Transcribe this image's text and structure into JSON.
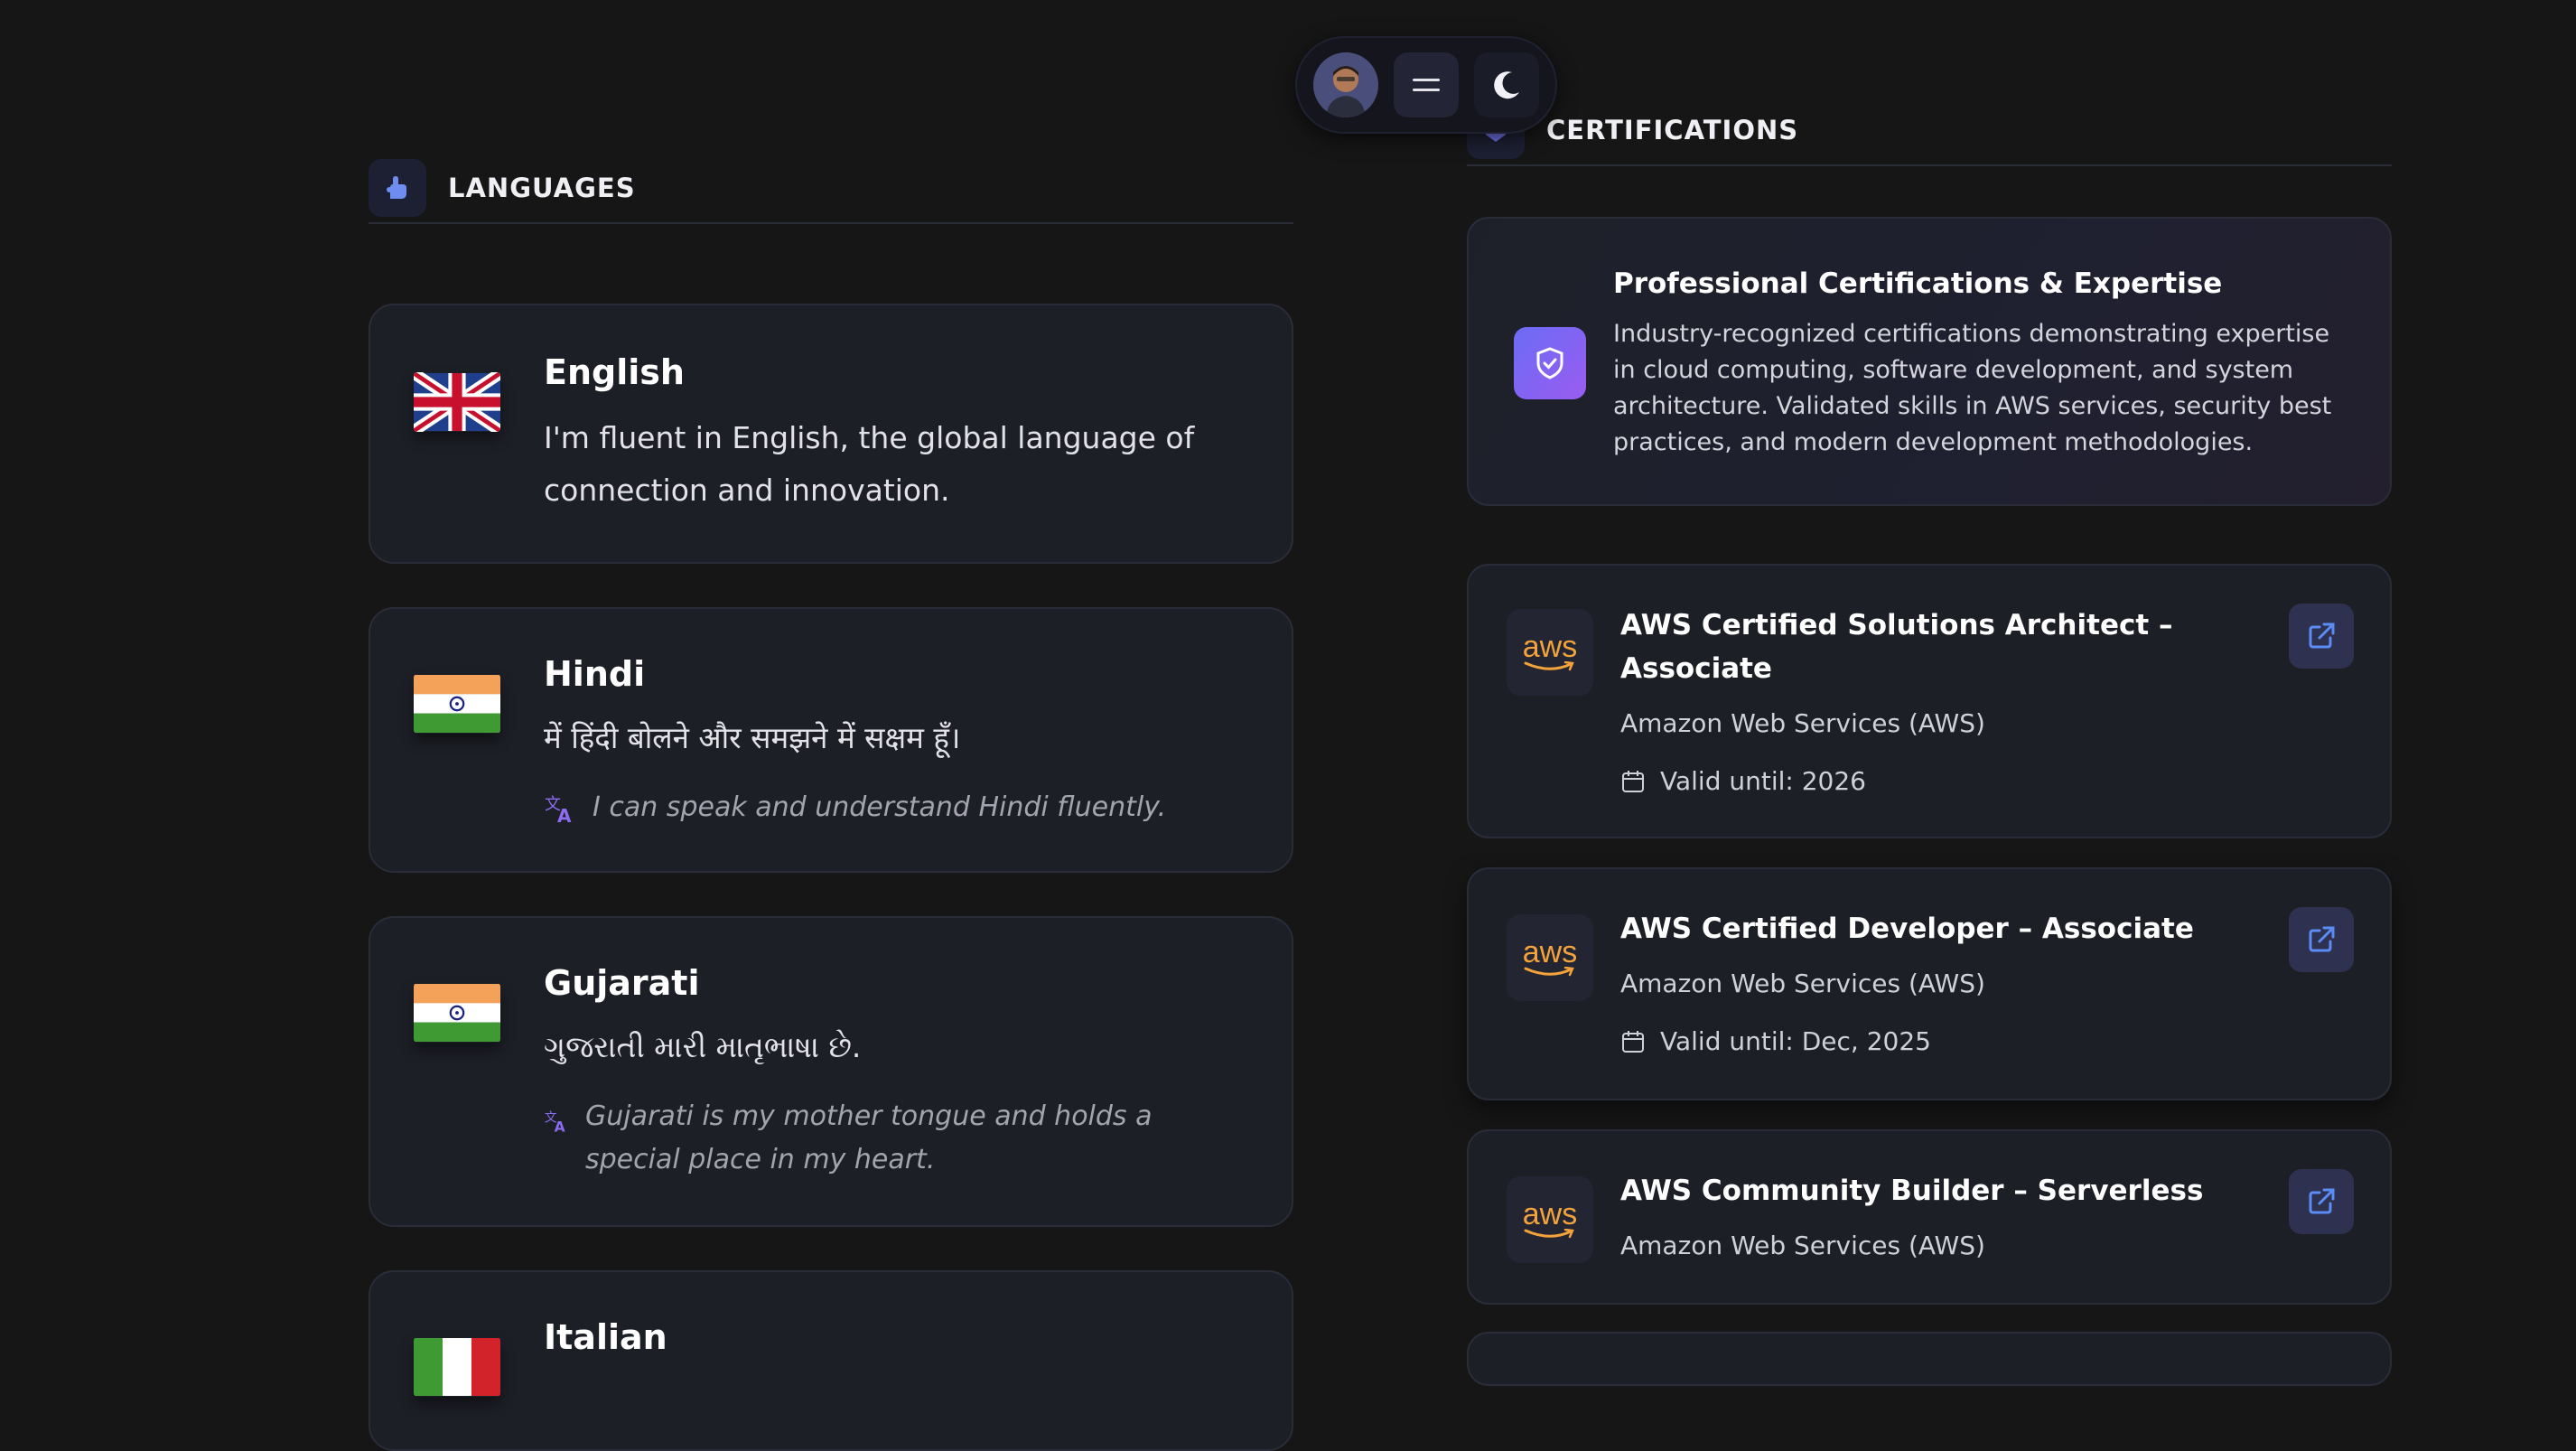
{
  "nav": {
    "avatar_alt": "profile avatar",
    "menu_icon": "menu-icon",
    "theme_icon": "moon-icon"
  },
  "languages": {
    "title": "LANGUAGES",
    "icon": "hand-icon",
    "items": [
      {
        "name": "English",
        "flag": "uk-flag",
        "description": "I'm fluent in English, the global language of connection and innovation."
      },
      {
        "name": "Hindi",
        "flag": "india-flag",
        "description": "में हिंदी बोलने और समझने में सक्षम हूँ।",
        "translation": "I can speak and understand Hindi fluently."
      },
      {
        "name": "Gujarati",
        "flag": "india-flag",
        "description": "ગુજરાતી મારી માતૃભાષા છે.",
        "translation": "Gujarati is my mother tongue and holds a special place in my heart."
      },
      {
        "name": "Italian",
        "flag": "italy-flag"
      }
    ]
  },
  "certifications": {
    "title": "CERTIFICATIONS",
    "icon": "shield-icon",
    "hero": {
      "title": "Professional Certifications & Expertise",
      "description": "Industry-recognized certifications demonstrating expertise in cloud computing, software development, and system architecture. Validated skills in AWS services, security best practices, and modern development methodologies."
    },
    "logo_text": "aws",
    "items": [
      {
        "title": "AWS Certified Solutions Architect – Associate",
        "issuer": "Amazon Web Services (AWS)",
        "valid": "Valid until: 2026"
      },
      {
        "title": "AWS Certified Developer – Associate",
        "issuer": "Amazon Web Services (AWS)",
        "valid": "Valid until: Dec, 2025"
      },
      {
        "title": "AWS Community Builder – Serverless",
        "issuer": "Amazon Web Services (AWS)"
      }
    ]
  },
  "colors": {
    "background": "#161616",
    "card": "#1d1f27",
    "accent": "#7b6cf6",
    "aws_orange": "#f3a33b",
    "link_blue": "#5b8cf5"
  }
}
